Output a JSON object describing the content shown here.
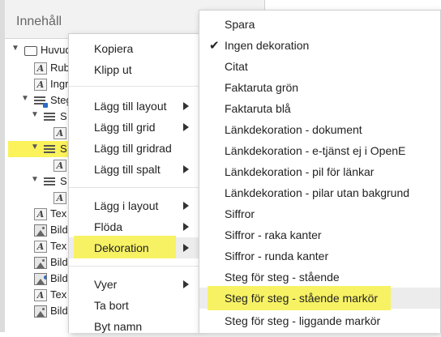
{
  "panel": {
    "title": "Innehåll"
  },
  "tree": [
    {
      "label": "Huvud",
      "icon": "box-icon",
      "toggle": "▼"
    },
    {
      "label": "Rub",
      "icon": "text-icon"
    },
    {
      "label": "Ingr",
      "icon": "text-icon"
    },
    {
      "label": "Steg",
      "icon": "step-layout-icon",
      "toggle": "▼"
    },
    {
      "label": "S",
      "icon": "rows-icon",
      "toggle": "▼"
    },
    {
      "label": "",
      "icon": "text-icon"
    },
    {
      "label": "S",
      "icon": "rows-icon",
      "toggle": "▼",
      "selected": true
    },
    {
      "label": "",
      "icon": "text-icon"
    },
    {
      "label": "S",
      "icon": "rows-icon",
      "toggle": "▼"
    },
    {
      "label": "",
      "icon": "text-icon"
    },
    {
      "label": "Tex",
      "icon": "text-icon"
    },
    {
      "label": "Bild",
      "icon": "image-icon"
    },
    {
      "label": "Tex",
      "icon": "text-icon"
    },
    {
      "label": "Bild",
      "icon": "image-icon"
    },
    {
      "label": "Bild",
      "icon": "image-step-icon"
    },
    {
      "label": "Tex",
      "icon": "text-icon"
    },
    {
      "label": "Bild",
      "icon": "image-icon"
    }
  ],
  "context_menu": {
    "items": [
      {
        "label": "Kopiera"
      },
      {
        "label": "Klipp ut"
      },
      {
        "label": "Lägg till layout",
        "submenu": true
      },
      {
        "label": "Lägg till grid",
        "submenu": true
      },
      {
        "label": "Lägg till gridrad"
      },
      {
        "label": "Lägg till spalt",
        "submenu": true
      },
      {
        "label": "Lägg i layout",
        "submenu": true
      },
      {
        "label": "Flöda",
        "submenu": true
      },
      {
        "label": "Dekoration",
        "submenu": true,
        "highlighted": true
      },
      {
        "label": "Vyer",
        "submenu": true
      },
      {
        "label": "Ta bort"
      },
      {
        "label": "Byt namn"
      }
    ]
  },
  "submenu": {
    "items": [
      {
        "label": "Spara"
      },
      {
        "label": "Ingen dekoration",
        "checked": true
      },
      {
        "label": "Citat"
      },
      {
        "label": "Faktaruta grön"
      },
      {
        "label": "Faktaruta blå"
      },
      {
        "label": "Länkdekoration - dokument"
      },
      {
        "label": "Länkdekoration - e-tjänst ej i OpenE"
      },
      {
        "label": "Länkdekoration - pil för länkar"
      },
      {
        "label": "Länkdekoration - pilar utan bakgrund"
      },
      {
        "label": "Siffror"
      },
      {
        "label": "Siffror - raka kanter"
      },
      {
        "label": "Siffror - runda kanter"
      },
      {
        "label": "Steg för steg - stående"
      },
      {
        "label": "Steg för steg - stående markör",
        "highlighted": true
      },
      {
        "label": "Steg för steg - liggande markör"
      }
    ]
  },
  "colors": {
    "highlight": "#f7f264",
    "selected_row": "#fbf25c",
    "hover": "#ececec"
  }
}
